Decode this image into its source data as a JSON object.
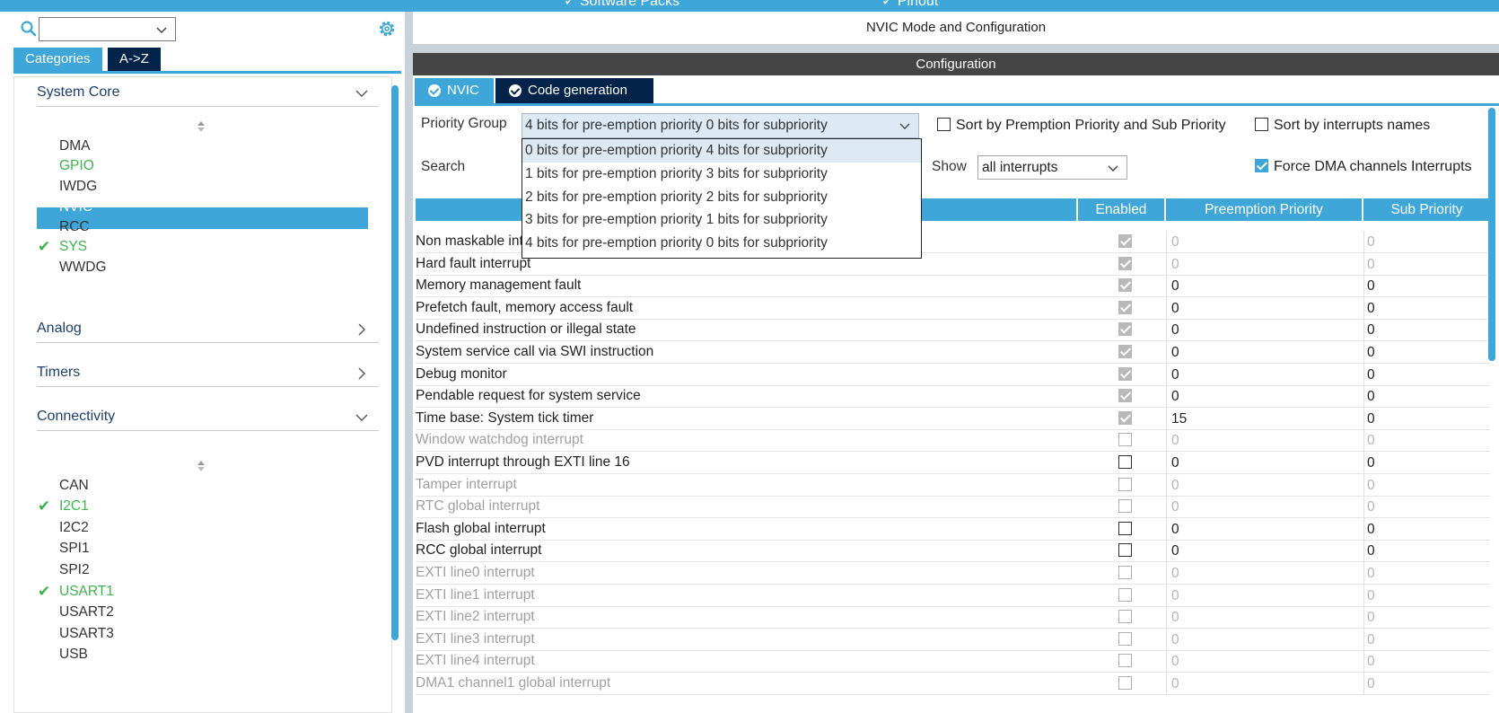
{
  "topbar": {
    "tab_software_packs": "✓ Software Packs",
    "tab_pinout": "✓ Pinout"
  },
  "left": {
    "tabs": {
      "categories": "Categories",
      "az": "A->Z"
    },
    "sections": {
      "system_core": "System Core",
      "analog": "Analog",
      "timers": "Timers",
      "connectivity": "Connectivity"
    },
    "system_core_items": [
      "DMA",
      "GPIO",
      "IWDG",
      "NVIC",
      "RCC",
      "SYS",
      "WWDG"
    ],
    "connectivity_items": [
      "CAN",
      "I2C1",
      "I2C2",
      "SPI1",
      "SPI2",
      "USART1",
      "USART2",
      "USART3",
      "USB"
    ]
  },
  "right": {
    "title": "NVIC Mode and Configuration",
    "config_bar": "Configuration",
    "tabs": {
      "nvic": "NVIC",
      "codegen": "Code generation"
    },
    "priority_group_label": "Priority Group",
    "priority_group_value": "4 bits for pre-emption priority 0 bits for subpriority",
    "sort_preempt_label": "Sort by Premption Priority and Sub Priority",
    "sort_names_label": "Sort by interrupts names",
    "search_label": "Search",
    "show_label": "Show",
    "show_value": "all interrupts",
    "force_dma_label": "Force DMA channels Interrupts",
    "priority_group_options": [
      "0 bits for pre-emption priority 4 bits for subpriority",
      "1 bits for pre-emption priority 3 bits for subpriority",
      "2 bits for pre-emption priority 2 bits for subpriority",
      "3 bits for pre-emption priority 1 bits for subpriority",
      "4 bits for pre-emption priority 0 bits for subpriority"
    ],
    "table": {
      "headers": {
        "enabled": "Enabled",
        "preempt": "Preemption Priority",
        "sub": "Sub Priority"
      },
      "rows": [
        {
          "name": "Non maskable interrupt",
          "enabled": "locked",
          "preempt": "0",
          "sub": "0"
        },
        {
          "name": "Hard fault interrupt",
          "enabled": "locked",
          "preempt": "0",
          "sub": "0"
        },
        {
          "name": "Memory management fault",
          "enabled": "locked",
          "preempt": "0",
          "sub": "0"
        },
        {
          "name": "Prefetch fault, memory access fault",
          "enabled": "locked",
          "preempt": "0",
          "sub": "0"
        },
        {
          "name": "Undefined instruction or illegal state",
          "enabled": "locked",
          "preempt": "0",
          "sub": "0"
        },
        {
          "name": "System service call via SWI instruction",
          "enabled": "locked",
          "preempt": "0",
          "sub": "0"
        },
        {
          "name": "Debug monitor",
          "enabled": "locked",
          "preempt": "0",
          "sub": "0"
        },
        {
          "name": "Pendable request for system service",
          "enabled": "locked",
          "preempt": "0",
          "sub": "0"
        },
        {
          "name": "Time base: System tick timer",
          "enabled": "locked",
          "preempt": "15",
          "sub": "0"
        },
        {
          "name": "Window watchdog interrupt",
          "enabled": "disabled",
          "preempt": "0",
          "sub": "0"
        },
        {
          "name": "PVD interrupt through EXTI line 16",
          "enabled": "off",
          "preempt": "0",
          "sub": "0"
        },
        {
          "name": "Tamper interrupt",
          "enabled": "disabled",
          "preempt": "0",
          "sub": "0"
        },
        {
          "name": "RTC global interrupt",
          "enabled": "disabled",
          "preempt": "0",
          "sub": "0"
        },
        {
          "name": "Flash global interrupt",
          "enabled": "off",
          "preempt": "0",
          "sub": "0"
        },
        {
          "name": "RCC global interrupt",
          "enabled": "off",
          "preempt": "0",
          "sub": "0"
        },
        {
          "name": "EXTI line0 interrupt",
          "enabled": "disabled",
          "preempt": "0",
          "sub": "0"
        },
        {
          "name": "EXTI line1 interrupt",
          "enabled": "disabled",
          "preempt": "0",
          "sub": "0"
        },
        {
          "name": "EXTI line2 interrupt",
          "enabled": "disabled",
          "preempt": "0",
          "sub": "0"
        },
        {
          "name": "EXTI line3 interrupt",
          "enabled": "disabled",
          "preempt": "0",
          "sub": "0"
        },
        {
          "name": "EXTI line4 interrupt",
          "enabled": "disabled",
          "preempt": "0",
          "sub": "0"
        },
        {
          "name": "DMA1 channel1 global interrupt",
          "enabled": "disabled",
          "preempt": "0",
          "sub": "0"
        }
      ]
    }
  },
  "colors": {
    "accent": "#3ea6d8",
    "dark_tab": "#03234b",
    "ok_green": "#3cb44b"
  }
}
